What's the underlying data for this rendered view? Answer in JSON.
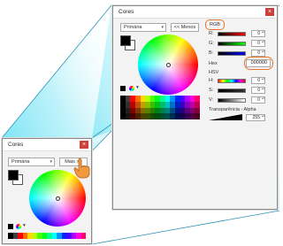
{
  "colors": {
    "accent_highlight": "#e8762a",
    "close_button": "#c9413a",
    "projection": "#3bd7f0"
  },
  "expanded_dialog": {
    "title": "Cores",
    "close_glyph": "×",
    "mode_select": "Primária",
    "less_button": "<< Menos",
    "rgb_section": "RGB",
    "channels": [
      {
        "label": "R:",
        "value": "0"
      },
      {
        "label": "G:",
        "value": "0"
      },
      {
        "label": "B:",
        "value": "0"
      }
    ],
    "hex_label": "Hex",
    "hex_value": "000000",
    "hsv_section": "HSV",
    "hsv_channels": [
      {
        "label": "H:",
        "value": "0"
      },
      {
        "label": "S:",
        "value": "0"
      },
      {
        "label": "V:",
        "value": "0"
      }
    ],
    "alpha_label": "Transparência - Alpha",
    "alpha_value": "255"
  },
  "compact_dialog": {
    "title": "Cores",
    "close_glyph": "×",
    "mode_select": "Primária",
    "more_button": "Mais >>"
  }
}
